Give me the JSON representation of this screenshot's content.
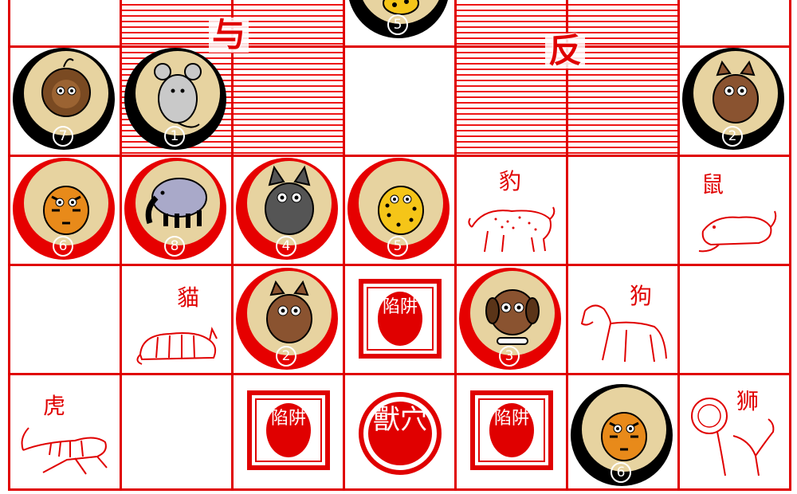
{
  "board": {
    "water_labels": [
      "与",
      "反"
    ],
    "trap_label": "陷阱",
    "den_label": "獸穴",
    "animal_labels": {
      "leopard": "豹",
      "rat": "鼠",
      "cat": "貓",
      "dog": "狗",
      "tiger": "虎",
      "lion": "狮"
    }
  },
  "pieces": [
    {
      "animal": "leopard",
      "rank": "5",
      "owner": "black"
    },
    {
      "animal": "lion",
      "rank": "7",
      "owner": "black"
    },
    {
      "animal": "rat",
      "rank": "1",
      "owner": "black"
    },
    {
      "animal": "cat",
      "rank": "2",
      "owner": "black"
    },
    {
      "animal": "tiger",
      "rank": "6",
      "owner": "red"
    },
    {
      "animal": "elephant",
      "rank": "8",
      "owner": "red"
    },
    {
      "animal": "wolf",
      "rank": "4",
      "owner": "red"
    },
    {
      "animal": "leopard",
      "rank": "5",
      "owner": "red"
    },
    {
      "animal": "cat",
      "rank": "2",
      "owner": "red"
    },
    {
      "animal": "dog",
      "rank": "3",
      "owner": "red"
    },
    {
      "animal": "tiger",
      "rank": "6",
      "owner": "black"
    }
  ],
  "colors": {
    "board_red": "#e00000",
    "piece_face": "#e7d3a0",
    "black_side": "#000000",
    "red_side": "#e60000"
  }
}
